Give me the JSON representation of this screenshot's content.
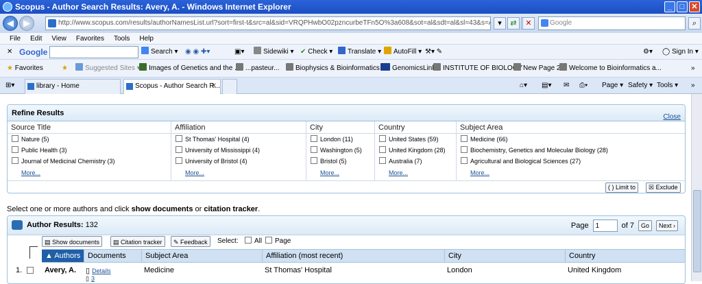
{
  "window": {
    "title": "Scopus - Author Search Results: Avery, A. - Windows Internet Explorer"
  },
  "address": {
    "url": "http://www.scopus.com/results/authorNamesList.url?sort=first-t&src=al&sid=VRQPHwbO02pzncurbeTFn5O%3a608&sot=al&sdt=al&sl=43&s=AUTH--LAST--NA",
    "search_placeholder": "Google"
  },
  "menu": [
    "File",
    "Edit",
    "View",
    "Favorites",
    "Tools",
    "Help"
  ],
  "google_toolbar": {
    "logo": "Google",
    "search": "Search",
    "sidewiki": "Sidewiki",
    "check": "Check",
    "translate": "Translate",
    "autofill": "AutoFill",
    "signin": "Sign In"
  },
  "favorites": {
    "label": "Favorites",
    "items": [
      "Suggested Sites",
      "Images of Genetics and the ...",
      "...pasteur...",
      "Biophysics & Bioinformatics ...",
      "GenomicsLinks",
      "INSTITUTE OF BIOLOGY",
      "New Page 2",
      "Welcome to Bioinformatics a..."
    ]
  },
  "tabs": [
    {
      "label": "library - Home"
    },
    {
      "label": "Scopus - Author Search R..."
    }
  ],
  "commandbar": {
    "page": "Page",
    "safety": "Safety",
    "tools": "Tools"
  },
  "refine": {
    "title": "Refine Results",
    "close": "Close",
    "columns": [
      {
        "header": "Source Title",
        "options": [
          "Nature (5)",
          "Public Health (3)",
          "Journal of Medicinal Chemistry (3)"
        ],
        "more": "More..."
      },
      {
        "header": "Affiliation",
        "options": [
          "St Thomas' Hospital (4)",
          "University of Mississippi (4)",
          "University of Bristol (4)"
        ],
        "more": "More..."
      },
      {
        "header": "City",
        "options": [
          "London (11)",
          "Washington (5)",
          "Bristol (5)"
        ],
        "more": "More..."
      },
      {
        "header": "Country",
        "options": [
          "United States (59)",
          "United Kingdom (28)",
          "Australia (7)"
        ],
        "more": "More..."
      },
      {
        "header": "Subject Area",
        "options": [
          "Medicine (66)",
          "Biochemistry, Genetics and Molecular Biology (28)",
          "Agricultural and Biological Sciences (27)"
        ],
        "more": "More..."
      }
    ],
    "limit_to": "Limit to",
    "exclude": "Exclude"
  },
  "instruction": {
    "pre": "Select one or more authors and click ",
    "b1": "show documents",
    "mid": " or ",
    "b2": "citation tracker",
    "post": "."
  },
  "results": {
    "title": "Author Results:",
    "count": "132",
    "page_label": "Page",
    "page_value": "1",
    "of": "of 7",
    "go": "Go",
    "next": "Next",
    "show_documents": "Show documents",
    "citation_tracker": "Citation tracker",
    "feedback": "Feedback",
    "select_label": "Select:",
    "select_all": "All",
    "select_page": "Page",
    "columns": [
      "Authors",
      "Documents",
      "Subject Area",
      "Affiliation (most recent)",
      "City",
      "Country"
    ],
    "rows": [
      {
        "num": "1.",
        "author": "Avery, A.",
        "details": "Details",
        "docs": "3",
        "subject": "Medicine",
        "affiliation": "St Thomas' Hospital",
        "city": "London",
        "country": "United Kingdom"
      }
    ]
  }
}
